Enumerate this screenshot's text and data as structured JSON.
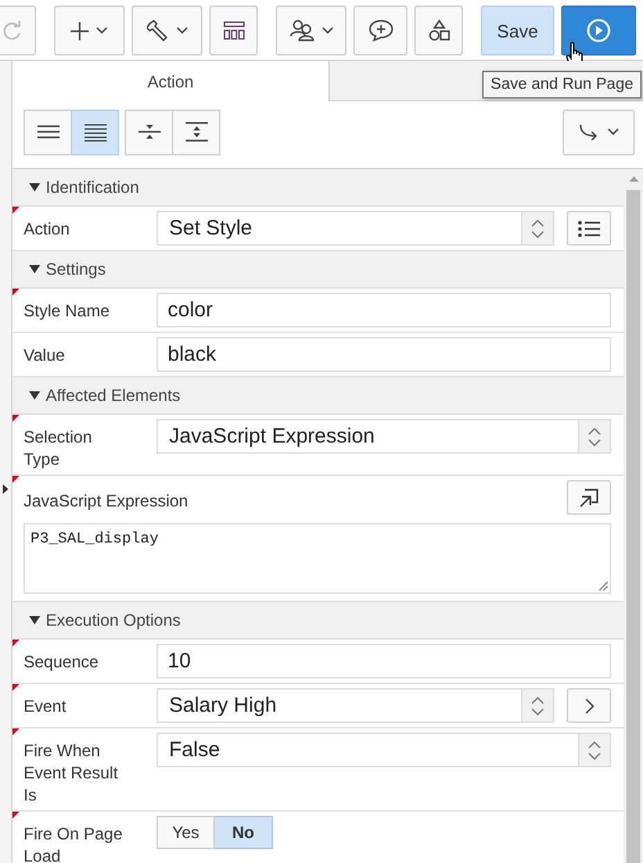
{
  "toolbar": {
    "groups": [
      [
        {
          "kind": "redo"
        }
      ],
      [
        {
          "kind": "add"
        },
        {
          "kind": "utilities"
        },
        {
          "kind": "layout"
        }
      ],
      [
        {
          "kind": "team"
        },
        {
          "kind": "comments"
        },
        {
          "kind": "shared"
        }
      ],
      [
        {
          "kind": "save",
          "label": "Save"
        },
        {
          "kind": "run"
        }
      ]
    ]
  },
  "tooltip": "Save and Run Page",
  "tabs": [
    {
      "label": "Action",
      "selected": true
    }
  ],
  "view_button_groups": [
    [
      {
        "kind": "compact",
        "selected": false
      },
      {
        "kind": "full",
        "selected": true
      }
    ],
    [
      {
        "kind": "collapse_all",
        "selected": false
      },
      {
        "kind": "expand_all",
        "selected": false
      }
    ]
  ],
  "sections": [
    {
      "title": "Identification",
      "expanded": true,
      "rows": [
        {
          "kind": "select",
          "label": "Action",
          "value": "Set Style",
          "required": true,
          "side_button": {
            "kind": "list"
          }
        }
      ]
    },
    {
      "title": "Settings",
      "expanded": true,
      "rows": [
        {
          "kind": "text",
          "label": "Style Name",
          "value": "color",
          "required": true
        },
        {
          "kind": "text",
          "label": "Value",
          "value": "black",
          "required": false
        }
      ]
    },
    {
      "title": "Affected Elements",
      "expanded": true,
      "rows": [
        {
          "kind": "select",
          "label": "Selection Type",
          "value": "JavaScript Expression",
          "required": true
        },
        {
          "kind": "code",
          "label": "JavaScript Expression",
          "value": "P3_SAL_display",
          "required": true,
          "side_button": {
            "kind": "expand"
          }
        }
      ]
    },
    {
      "title": "Execution Options",
      "expanded": true,
      "rows": [
        {
          "kind": "text",
          "label": "Sequence",
          "value": "10",
          "required": true
        },
        {
          "kind": "select",
          "label": "Event",
          "value": "Salary High",
          "required": true,
          "side_button": {
            "kind": "next"
          }
        },
        {
          "kind": "select",
          "label": "Fire When Event Result Is",
          "value": "False",
          "required": true
        },
        {
          "kind": "toggle",
          "label": "Fire On Page Load",
          "required": true,
          "options": [
            {
              "label": "Yes",
              "selected": false
            },
            {
              "label": "No",
              "selected": true
            }
          ]
        }
      ]
    }
  ]
}
